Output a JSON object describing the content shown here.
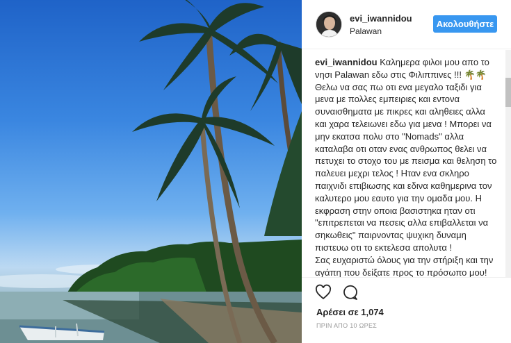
{
  "post": {
    "username": "evi_iwannidou",
    "location": "Palawan",
    "follow_label": "Ακολουθήστε",
    "caption_user": "evi_iwannidou",
    "caption_text": " Καλημερα φιλοι μου απο το νησι Palawan εδω στις Φιλιππινες !!! 🌴🌴 Θελω να σας πω οτι ενα μεγαλο ταξιδι για μενα με πολλες εμπειριες και εντονα συναισθηματα με πικρες και αληθειες αλλα και χαρα τελειωνει εδω για μενα ! Μπορει να μην εκατσα πολυ στο \"Nomads\" αλλα καταλαβα οτι οταν ενας ανθρωπος θελει να πετυχει το στοχο του με πεισμα και θεληση το παλευει μεχρι τελος ! Ηταν ενα σκληρο παιχνιδι επιβιωσης και εδινα καθημερινα τον καλυτερο μου εαυτο για την ομαδα μου. Η εκφραση στην οποια βασιστηκα ηταν οτι \"επιτρεπεται να πεσεις αλλα επιβαλλεται να σηκωθεις\" παιρνοντας ψυχικη δυναμη πιστευω οτι το εκτελεσα απολυτα !\nΣας ευχαριστώ όλους για την στήριξη και την αγάπη που δείξατε προς το πρόσωπο μου!",
    "likes": "Αρέσει σε 1,074",
    "time": "ΠΡΙΝ ΑΠΟ 10 ΩΡΕΣ"
  },
  "icons": {
    "like": "heart-icon",
    "comment": "comment-icon"
  }
}
